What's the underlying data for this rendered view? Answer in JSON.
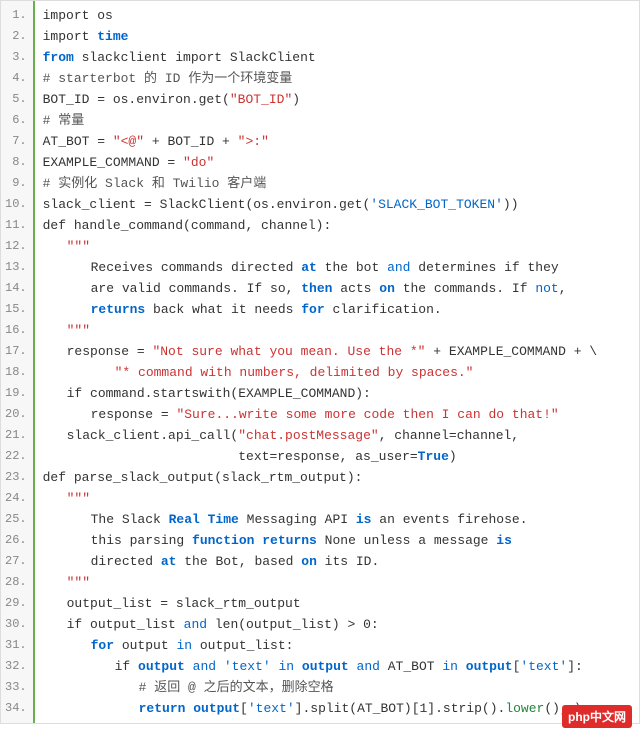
{
  "badge": "php中文网",
  "lines": [
    {
      "n": "1.",
      "segs": [
        {
          "t": "import os",
          "c": ""
        }
      ]
    },
    {
      "n": "2.",
      "segs": [
        {
          "t": "import ",
          "c": ""
        },
        {
          "t": "time",
          "c": "kw"
        }
      ]
    },
    {
      "n": "3.",
      "segs": [
        {
          "t": "from",
          "c": "kw"
        },
        {
          "t": " slackclient import SlackClient",
          "c": ""
        }
      ]
    },
    {
      "n": "4.",
      "segs": [
        {
          "t": "# starterbot 的 ID 作为一个环境变量",
          "c": "comment"
        }
      ]
    },
    {
      "n": "5.",
      "segs": [
        {
          "t": "BOT_ID = os.environ.get(",
          "c": ""
        },
        {
          "t": "\"BOT_ID\"",
          "c": "str"
        },
        {
          "t": ")",
          "c": ""
        }
      ]
    },
    {
      "n": "6.",
      "segs": [
        {
          "t": "# 常量",
          "c": "comment"
        }
      ]
    },
    {
      "n": "7.",
      "segs": [
        {
          "t": "AT_BOT = ",
          "c": ""
        },
        {
          "t": "\"<@\"",
          "c": "str"
        },
        {
          "t": " + BOT_ID + ",
          "c": ""
        },
        {
          "t": "\">:\"",
          "c": "str"
        }
      ]
    },
    {
      "n": "8.",
      "segs": [
        {
          "t": "EXAMPLE_COMMAND = ",
          "c": ""
        },
        {
          "t": "\"do\"",
          "c": "str"
        }
      ]
    },
    {
      "n": "9.",
      "segs": [
        {
          "t": "# 实例化 Slack 和 Twilio 客户端",
          "c": "comment"
        }
      ]
    },
    {
      "n": "10.",
      "segs": [
        {
          "t": "slack_client = SlackClient(os.environ.get(",
          "c": ""
        },
        {
          "t": "'SLACK_BOT_TOKEN'",
          "c": "strb"
        },
        {
          "t": "))",
          "c": ""
        }
      ]
    },
    {
      "n": "11.",
      "segs": [
        {
          "t": "def handle_command(command, channel):",
          "c": ""
        }
      ]
    },
    {
      "n": "12.",
      "indent": "ind1",
      "segs": [
        {
          "t": "\"\"\"",
          "c": "str"
        }
      ]
    },
    {
      "n": "13.",
      "indent": "ind2",
      "segs": [
        {
          "t": "Receives commands directed ",
          "c": ""
        },
        {
          "t": "at",
          "c": "kw"
        },
        {
          "t": " the bot ",
          "c": ""
        },
        {
          "t": "and",
          "c": "kw2"
        },
        {
          "t": " determines if they",
          "c": ""
        }
      ]
    },
    {
      "n": "14.",
      "indent": "ind2",
      "segs": [
        {
          "t": "are valid commands. If so, ",
          "c": ""
        },
        {
          "t": "then",
          "c": "kw"
        },
        {
          "t": " acts ",
          "c": ""
        },
        {
          "t": "on",
          "c": "kw"
        },
        {
          "t": " the commands. If ",
          "c": ""
        },
        {
          "t": "not",
          "c": "kw2"
        },
        {
          "t": ",",
          "c": ""
        }
      ]
    },
    {
      "n": "15.",
      "indent": "ind2",
      "segs": [
        {
          "t": "returns",
          "c": "kw"
        },
        {
          "t": " back what it needs ",
          "c": ""
        },
        {
          "t": "for",
          "c": "kw"
        },
        {
          "t": " clarification.",
          "c": ""
        }
      ]
    },
    {
      "n": "16.",
      "indent": "ind1",
      "segs": [
        {
          "t": "\"\"\"",
          "c": "str"
        }
      ]
    },
    {
      "n": "17.",
      "indent": "ind1",
      "segs": [
        {
          "t": "response = ",
          "c": ""
        },
        {
          "t": "\"Not sure what you mean. Use the *\"",
          "c": "str"
        },
        {
          "t": " + EXAMPLE_COMMAND + \\",
          "c": ""
        }
      ]
    },
    {
      "n": "18.",
      "indent": "ind3",
      "segs": [
        {
          "t": "\"* command with numbers, delimited by spaces.\"",
          "c": "str"
        }
      ]
    },
    {
      "n": "19.",
      "indent": "ind1",
      "segs": [
        {
          "t": "if command.startswith(EXAMPLE_COMMAND):",
          "c": ""
        }
      ]
    },
    {
      "n": "20.",
      "indent": "ind2",
      "segs": [
        {
          "t": "response = ",
          "c": ""
        },
        {
          "t": "\"Sure...write some more code then I can do that!\"",
          "c": "str"
        }
      ]
    },
    {
      "n": "21.",
      "indent": "ind1",
      "segs": [
        {
          "t": "slack_client.api_call(",
          "c": ""
        },
        {
          "t": "\"chat.postMessage\"",
          "c": "str"
        },
        {
          "t": ", channel=channel,",
          "c": ""
        }
      ]
    },
    {
      "n": "22.",
      "indent": "ind1",
      "segs": [
        {
          "t": "                      text=response, as_user=",
          "c": ""
        },
        {
          "t": "True",
          "c": "kw"
        },
        {
          "t": ")",
          "c": ""
        }
      ]
    },
    {
      "n": "23.",
      "segs": [
        {
          "t": "def parse_slack_output(slack_rtm_output):",
          "c": ""
        }
      ]
    },
    {
      "n": "24.",
      "indent": "ind1",
      "segs": [
        {
          "t": "\"\"\"",
          "c": "str"
        }
      ]
    },
    {
      "n": "25.",
      "indent": "ind2",
      "segs": [
        {
          "t": "The Slack ",
          "c": ""
        },
        {
          "t": "Real Time",
          "c": "kw"
        },
        {
          "t": " Messaging API ",
          "c": ""
        },
        {
          "t": "is",
          "c": "kw"
        },
        {
          "t": " an events firehose.",
          "c": ""
        }
      ]
    },
    {
      "n": "26.",
      "indent": "ind2",
      "segs": [
        {
          "t": "this parsing ",
          "c": ""
        },
        {
          "t": "function returns",
          "c": "kw"
        },
        {
          "t": " None unless a message ",
          "c": ""
        },
        {
          "t": "is",
          "c": "kw"
        }
      ]
    },
    {
      "n": "27.",
      "indent": "ind2",
      "segs": [
        {
          "t": "directed ",
          "c": ""
        },
        {
          "t": "at",
          "c": "kw"
        },
        {
          "t": " the Bot, based ",
          "c": ""
        },
        {
          "t": "on",
          "c": "kw"
        },
        {
          "t": " its ID.",
          "c": ""
        }
      ]
    },
    {
      "n": "28.",
      "indent": "ind1",
      "segs": [
        {
          "t": "\"\"\"",
          "c": "str"
        }
      ]
    },
    {
      "n": "29.",
      "indent": "ind1",
      "segs": [
        {
          "t": "output_list = slack_rtm_output",
          "c": ""
        }
      ]
    },
    {
      "n": "30.",
      "indent": "ind1",
      "segs": [
        {
          "t": "if output_list ",
          "c": ""
        },
        {
          "t": "and",
          "c": "kw2"
        },
        {
          "t": " len(output_list) > 0:",
          "c": ""
        }
      ]
    },
    {
      "n": "31.",
      "indent": "ind2",
      "segs": [
        {
          "t": "for",
          "c": "kw"
        },
        {
          "t": " output ",
          "c": ""
        },
        {
          "t": "in",
          "c": "kw2"
        },
        {
          "t": " output_list:",
          "c": ""
        }
      ]
    },
    {
      "n": "32.",
      "indent": "ind3",
      "segs": [
        {
          "t": "if ",
          "c": ""
        },
        {
          "t": "output",
          "c": "kw"
        },
        {
          "t": " ",
          "c": ""
        },
        {
          "t": "and",
          "c": "kw2"
        },
        {
          "t": " ",
          "c": ""
        },
        {
          "t": "'text'",
          "c": "strb"
        },
        {
          "t": " ",
          "c": ""
        },
        {
          "t": "in",
          "c": "kw2"
        },
        {
          "t": " ",
          "c": ""
        },
        {
          "t": "output",
          "c": "kw"
        },
        {
          "t": " ",
          "c": ""
        },
        {
          "t": "and",
          "c": "kw2"
        },
        {
          "t": " AT_BOT ",
          "c": ""
        },
        {
          "t": "in",
          "c": "kw2"
        },
        {
          "t": " ",
          "c": ""
        },
        {
          "t": "output",
          "c": "kw"
        },
        {
          "t": "[",
          "c": ""
        },
        {
          "t": "'text'",
          "c": "strb"
        },
        {
          "t": "]:",
          "c": ""
        }
      ]
    },
    {
      "n": "33.",
      "indent": "ind4",
      "segs": [
        {
          "t": "# 返回 @ 之后的文本，删除空格",
          "c": "comment"
        }
      ]
    },
    {
      "n": "34.",
      "indent": "ind4",
      "segs": [
        {
          "t": "return",
          "c": "kw"
        },
        {
          "t": " ",
          "c": ""
        },
        {
          "t": "output",
          "c": "kw"
        },
        {
          "t": "[",
          "c": ""
        },
        {
          "t": "'text'",
          "c": "strb"
        },
        {
          "t": "].split(AT_BOT)[1].strip().",
          "c": ""
        },
        {
          "t": "lower",
          "c": "strg"
        },
        {
          "t": "(), \\",
          "c": ""
        }
      ]
    }
  ]
}
